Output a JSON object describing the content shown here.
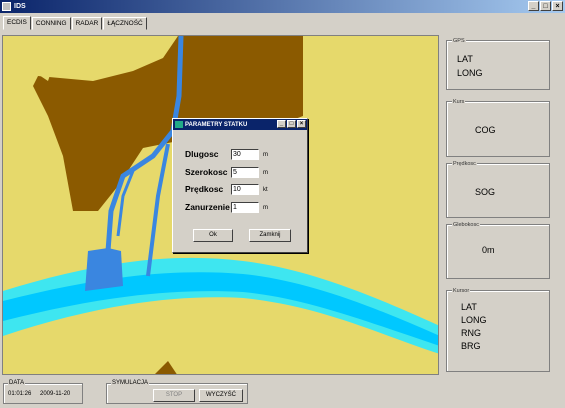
{
  "window": {
    "title": "IDS",
    "buttons": [
      "_",
      "□",
      "×"
    ]
  },
  "tabs": [
    {
      "label": "ECDIS",
      "active": true
    },
    {
      "label": "CONNING",
      "active": false
    },
    {
      "label": "RADAR",
      "active": false
    },
    {
      "label": "ŁĄCZNOŚĆ",
      "active": false
    }
  ],
  "panels": {
    "gps": {
      "legend": "GPS",
      "lines": [
        "LAT",
        "LONG"
      ]
    },
    "kurs": {
      "legend": "Kurs",
      "value": "COG"
    },
    "predkosc": {
      "legend": "Prędkosc",
      "value": "SOG"
    },
    "glebokosc": {
      "legend": "Glebokosc",
      "value": "0m"
    },
    "kursor": {
      "legend": "Kursor",
      "lines": [
        "LAT",
        "LONG",
        "RNG",
        "BRG"
      ]
    }
  },
  "dialog": {
    "title": "PARAMETRY STATKU",
    "buttons": [
      "_",
      "□",
      "×"
    ],
    "fields": [
      {
        "label": "Dlugosc",
        "value": "30",
        "unit": "m"
      },
      {
        "label": "Szerokosc",
        "value": "5",
        "unit": "m"
      },
      {
        "label": "Prędkosc",
        "value": "10",
        "unit": "kt"
      },
      {
        "label": "Zanurzenie",
        "value": "1",
        "unit": "m"
      }
    ],
    "ok_label": "Ok",
    "close_label": "Zamknij"
  },
  "data_group": {
    "legend": "DATA",
    "time": "01:01:26",
    "date": "2009-11-20"
  },
  "symulacja": {
    "legend": "SYMULACJA",
    "stop_label": "STOP",
    "clear_label": "WYCZYŚĆ"
  },
  "colors": {
    "land": "#e6d96b",
    "shore": "#8b5a00",
    "river_light": "#3ee6f0",
    "river_mid": "#00c8ff",
    "channel": "#3a86e0",
    "title_bar": "#0a246a"
  }
}
